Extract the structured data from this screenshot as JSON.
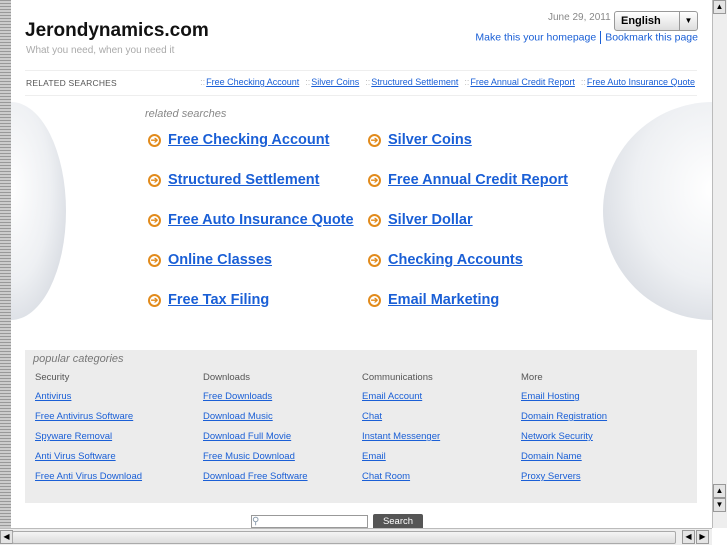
{
  "header": {
    "title": "Jerondynamics.com",
    "tagline": "What you need, when you need it",
    "date": "June 29, 2011",
    "language": "English",
    "homepage_link": "Make this your homepage",
    "bookmark_link": "Bookmark this page"
  },
  "related_bar": {
    "label": "RELATED SEARCHES",
    "links": [
      "Free Checking Account",
      "Silver Coins",
      "Structured Settlement",
      "Free Annual Credit Report",
      "Free Auto Insurance Quote"
    ]
  },
  "related": {
    "title": "related searches",
    "items": [
      "Free Checking Account",
      "Silver Coins",
      "Structured Settlement",
      "Free Annual Credit Report",
      "Free Auto Insurance Quote",
      "Silver Dollar",
      "Online Classes",
      "Checking Accounts",
      "Free Tax Filing",
      "Email Marketing"
    ]
  },
  "popular": {
    "title": "popular categories",
    "columns": [
      {
        "heading": "Security",
        "links": [
          "Antivirus",
          "Free Antivirus Software",
          "Spyware Removal",
          "Anti Virus Software",
          "Free Anti Virus Download"
        ]
      },
      {
        "heading": "Downloads",
        "links": [
          "Free Downloads",
          "Download Music",
          "Download Full Movie",
          "Free Music Download",
          "Download Free Software"
        ]
      },
      {
        "heading": "Communications",
        "links": [
          "Email Account",
          "Chat",
          "Instant Messenger",
          "Email",
          "Chat Room"
        ]
      },
      {
        "heading": "More",
        "links": [
          "Email Hosting",
          "Domain Registration",
          "Network Security",
          "Domain Name",
          "Proxy Servers"
        ]
      }
    ]
  },
  "search": {
    "button": "Search",
    "value": ""
  }
}
